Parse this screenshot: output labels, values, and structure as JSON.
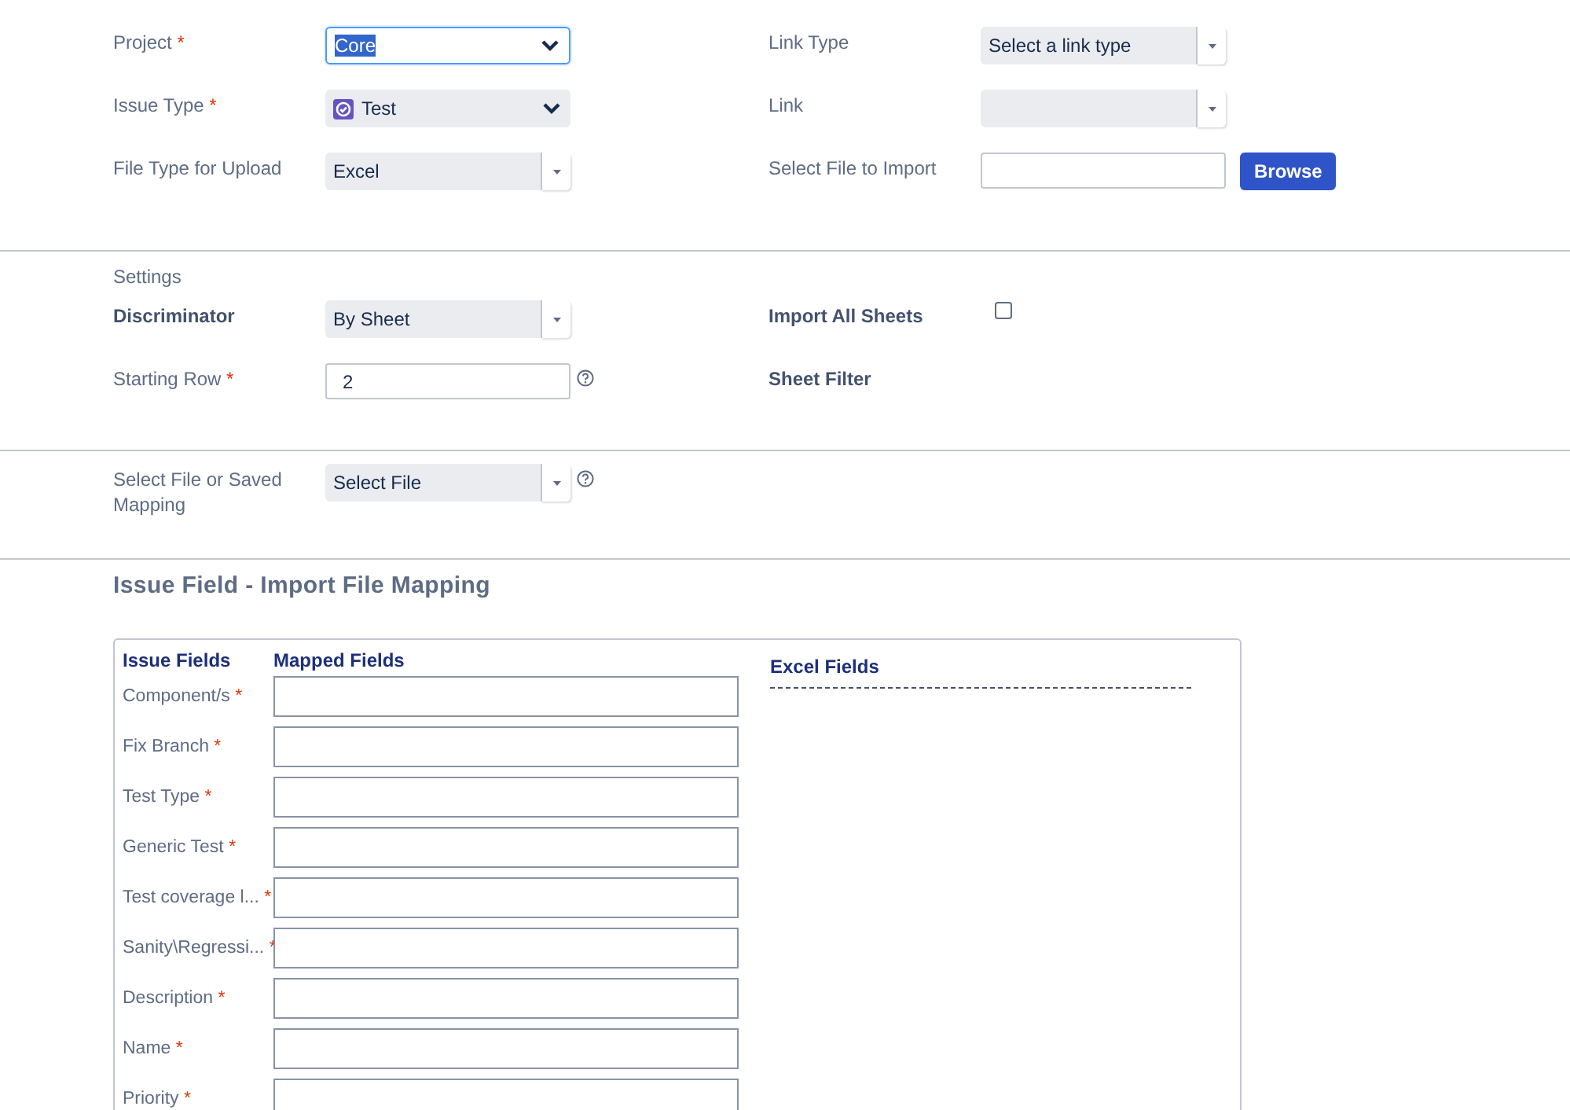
{
  "required_mark": "*",
  "top": {
    "left": [
      {
        "label": "Project",
        "required": true,
        "bold": false,
        "kind": "select",
        "value": "Core",
        "focused": true
      },
      {
        "label": "Issue Type",
        "required": true,
        "bold": false,
        "kind": "icon-select",
        "value": "Test"
      },
      {
        "label": "File Type for Upload",
        "required": false,
        "bold": false,
        "kind": "dropdown",
        "value": "Excel"
      }
    ],
    "right": [
      {
        "label": "Link Type",
        "required": false,
        "bold": false,
        "kind": "dropdown",
        "value": "Select a link type"
      },
      {
        "label": "Link",
        "required": false,
        "bold": false,
        "kind": "dropdown"
      },
      {
        "label": "Select File to Import",
        "required": false,
        "bold": false,
        "kind": "file",
        "button": "Browse"
      }
    ]
  },
  "settings": {
    "heading": "Settings",
    "left": [
      {
        "label": "Discriminator",
        "required": false,
        "bold": true,
        "kind": "dropdown",
        "value": "By Sheet"
      },
      {
        "label": "Starting Row",
        "required": true,
        "bold": false,
        "kind": "text",
        "value": "2",
        "help": true
      }
    ],
    "right": [
      {
        "label": "Import All Sheets",
        "required": false,
        "bold": true,
        "kind": "checkbox",
        "checked": false
      },
      {
        "label": "Sheet Filter",
        "required": false,
        "bold": true,
        "kind": "none"
      }
    ]
  },
  "mapping_source": {
    "left": [
      {
        "label": "Select File or Saved Mapping",
        "required": false,
        "bold": false,
        "kind": "dropdown",
        "value": "Select File",
        "help": true
      }
    ]
  },
  "mapping": {
    "title": "Issue Field - Import File Mapping",
    "columns": [
      "Issue Fields",
      "Mapped Fields"
    ],
    "excel_title": "Excel Fields",
    "rows": [
      {
        "label": "Component/s",
        "required": true
      },
      {
        "label": "Fix Branch",
        "required": true
      },
      {
        "label": "Test Type",
        "required": true
      },
      {
        "label": "Generic Test",
        "required": true
      },
      {
        "label": "Test coverage l...",
        "required": true
      },
      {
        "label": "Sanity\\Regressi...",
        "required": true
      },
      {
        "label": "Description",
        "required": true
      },
      {
        "label": "Name",
        "required": true
      },
      {
        "label": "Priority",
        "required": true
      }
    ]
  }
}
